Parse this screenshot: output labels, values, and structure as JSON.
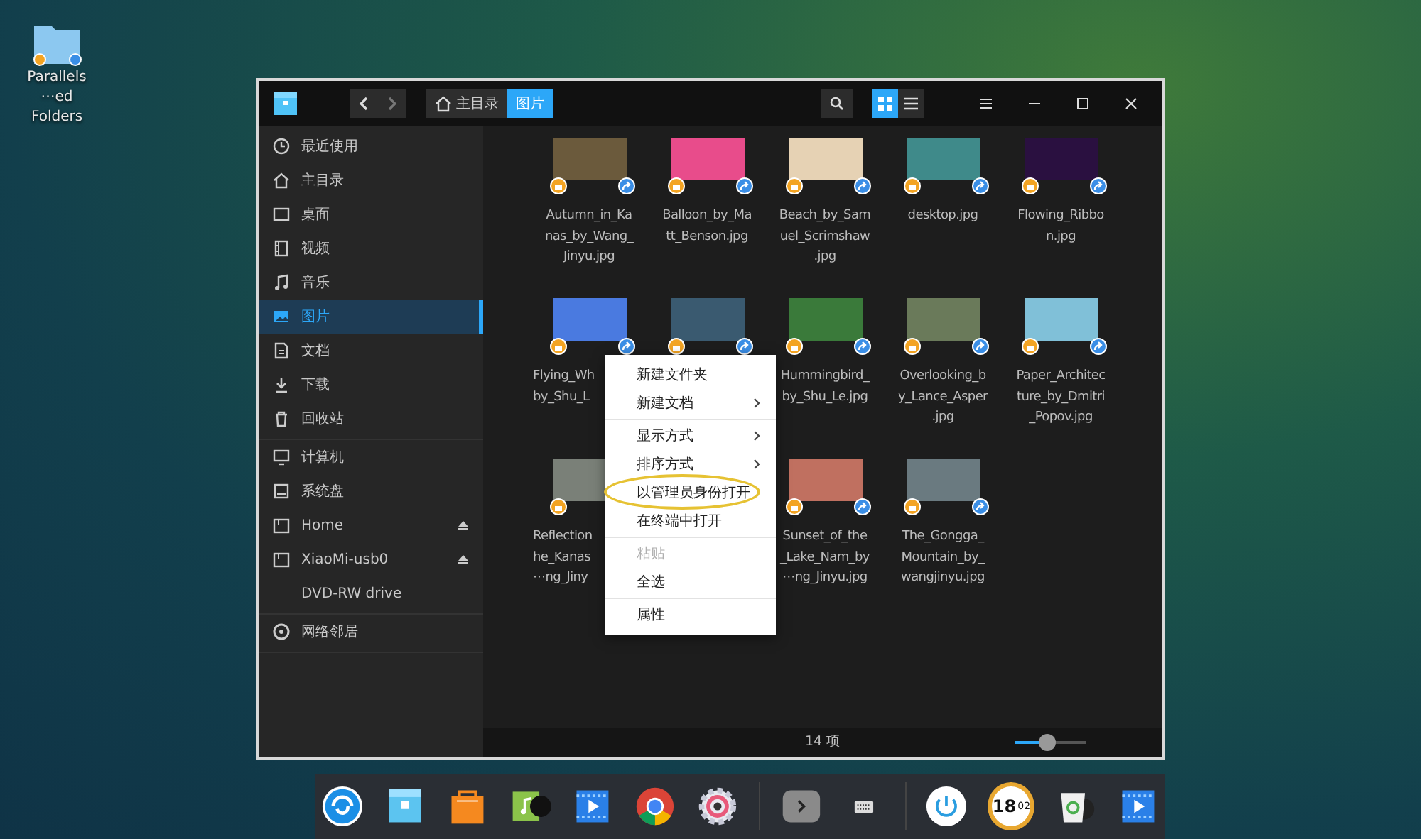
{
  "desktop_icon": {
    "lines": [
      "Parallels",
      "⋯ed Folders"
    ]
  },
  "window": {
    "breadcrumb": [
      {
        "label": "主目录",
        "selected": false
      },
      {
        "label": "图片",
        "selected": true
      }
    ],
    "view_modes": [
      {
        "kind": "icon",
        "selected": true
      },
      {
        "kind": "list",
        "selected": false
      }
    ]
  },
  "sidebar": {
    "groups": [
      [
        {
          "label": "最近使用",
          "selected": false
        },
        {
          "label": "主目录",
          "selected": false
        },
        {
          "label": "桌面",
          "selected": false
        },
        {
          "label": "视频",
          "selected": false
        },
        {
          "label": "音乐",
          "selected": false
        },
        {
          "label": "图片",
          "selected": true
        },
        {
          "label": "文档",
          "selected": false
        },
        {
          "label": "下载",
          "selected": false
        },
        {
          "label": "回收站",
          "selected": false
        }
      ],
      [
        {
          "label": "计算机",
          "selected": false
        },
        {
          "label": "系统盘",
          "selected": false
        },
        {
          "label": "Home",
          "selected": false,
          "ejectable": true
        },
        {
          "label": "XiaoMi-usb0",
          "selected": false,
          "ejectable": true
        },
        {
          "label": "DVD-RW drive",
          "selected": false
        }
      ],
      [
        {
          "label": "网络邻居",
          "selected": false
        }
      ]
    ]
  },
  "files": [
    {
      "kind": "file",
      "lines": [
        "Autumn_in_Ka",
        "nas_by_Wang_",
        "Jinyu.jpg"
      ]
    },
    {
      "kind": "file",
      "lines": [
        "Balloon_by_Ma",
        "tt_Benson.jpg"
      ]
    },
    {
      "kind": "file",
      "lines": [
        "Beach_by_Sam",
        "uel_Scrimshaw",
        ".jpg"
      ]
    },
    {
      "kind": "file",
      "lines": [
        "desktop.jpg"
      ]
    },
    {
      "kind": "file",
      "lines": [
        "Flowing_Ribbo",
        "n.jpg"
      ]
    },
    {
      "kind": "file",
      "lines": [
        "Flying_Wh",
        "by_Shu_L"
      ]
    },
    {
      "kind": "file"
    },
    {
      "kind": "file",
      "lines": [
        "Hummingbird_",
        "by_Shu_Le.jpg"
      ]
    },
    {
      "kind": "file",
      "lines": [
        "Overlooking_b",
        "y_Lance_Asper",
        ".jpg"
      ]
    },
    {
      "kind": "file",
      "lines": [
        "Paper_Architec",
        "ture_by_Dmitri",
        "_Popov.jpg"
      ]
    },
    {
      "kind": "file",
      "lines": [
        "Reflection",
        "he_Kanas",
        "⋯ng_Jiny"
      ]
    },
    {
      "kind": "covered"
    },
    {
      "kind": "file",
      "lines": [
        "Sunset_of_the",
        "_Lake_Nam_by",
        "⋯ng_Jinyu.jpg"
      ]
    },
    {
      "kind": "file",
      "lines": [
        "The_Gongga_",
        "Mountain_by_",
        "wangjinyu.jpg"
      ]
    }
  ],
  "context_menu": {
    "groups": [
      [
        {
          "label": "新建文件夹",
          "submenu": false,
          "disabled": false,
          "circled": false
        },
        {
          "label": "新建文档",
          "submenu": true,
          "disabled": false,
          "circled": false
        }
      ],
      [
        {
          "label": "显示方式",
          "submenu": true,
          "disabled": false,
          "circled": false
        },
        {
          "label": "排序方式",
          "submenu": true,
          "disabled": false,
          "circled": false
        },
        {
          "label": "以管理员身份打开",
          "submenu": false,
          "disabled": false,
          "circled": true
        },
        {
          "label": "在终端中打开",
          "submenu": false,
          "disabled": false,
          "circled": false
        }
      ],
      [
        {
          "label": "粘贴",
          "submenu": false,
          "disabled": true,
          "circled": false
        },
        {
          "label": "全选",
          "submenu": false,
          "disabled": false,
          "circled": false
        }
      ],
      [
        {
          "label": "属性",
          "submenu": false,
          "disabled": false,
          "circled": false
        }
      ]
    ]
  },
  "status_bar": {
    "count": "14 项",
    "zoom": {
      "level": 0.45
    }
  },
  "dock": {
    "clock": {
      "hour": "18",
      "minute": "02"
    }
  }
}
